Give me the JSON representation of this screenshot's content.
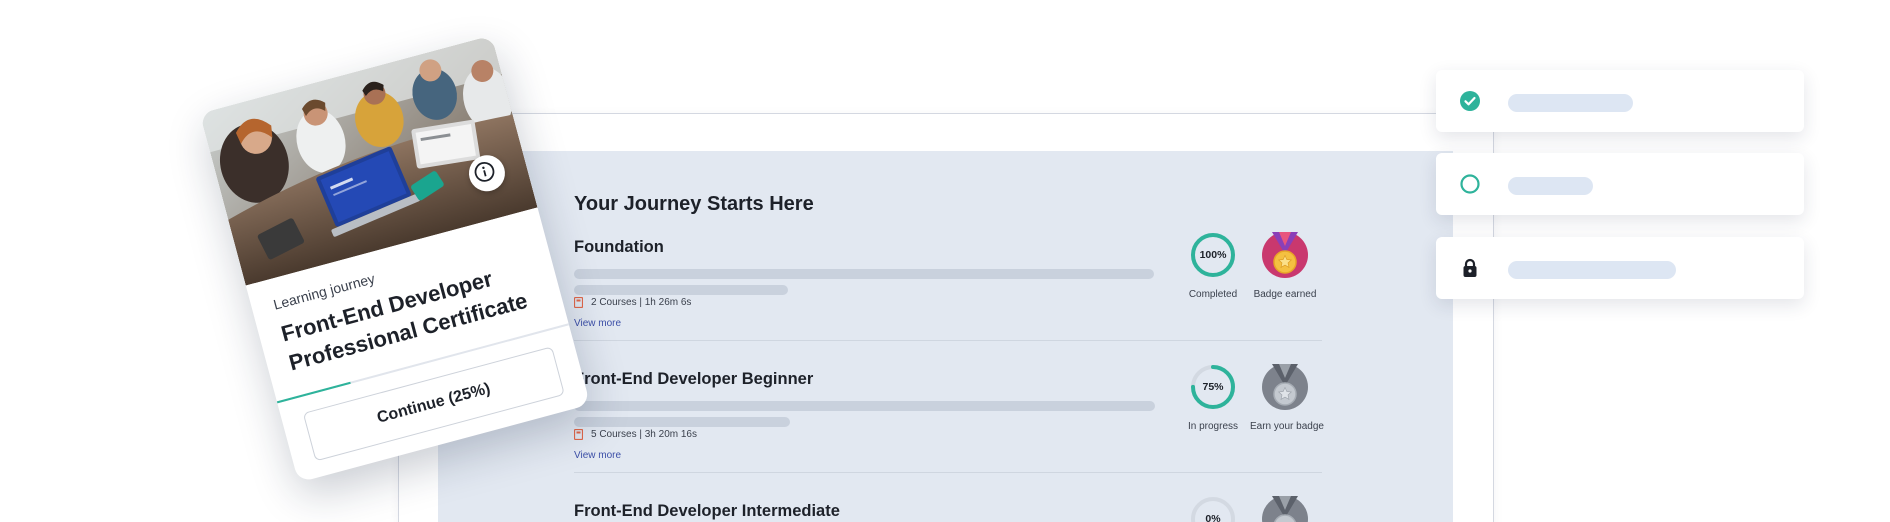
{
  "journey": {
    "heading": "Your Journey Starts Here",
    "modules": [
      {
        "title": "Foundation",
        "meta": "2 Courses | 1h 26m 6s",
        "view_more": "View more",
        "progress_label": "100%",
        "progress": 1.0,
        "status": "Completed",
        "badge_label": "Badge earned",
        "badge_state": "earned"
      },
      {
        "title": "Front-End Developer Beginner",
        "meta": "5 Courses | 3h 20m 16s",
        "view_more": "View more",
        "progress_label": "75%",
        "progress": 0.75,
        "status": "In progress",
        "badge_label": "Earn your badge",
        "badge_state": "locked"
      },
      {
        "title": "Front-End Developer Intermediate",
        "progress_label": "0%",
        "progress": 0.0,
        "badge_state": "locked"
      }
    ]
  },
  "card": {
    "eyebrow": "Learning journey",
    "title": "Front-End Developer Professional Certificate",
    "progress": 0.25,
    "button_label": "Continue (25%)",
    "photo_icon": "info-icon"
  },
  "checklist": [
    {
      "state": "done",
      "icon": "check-circle-icon",
      "bar_fraction": 0.44
    },
    {
      "state": "open",
      "icon": "empty-circle-icon",
      "bar_fraction": 0.3
    },
    {
      "state": "locked",
      "icon": "lock-icon",
      "bar_fraction": 0.59
    }
  ],
  "colors": {
    "accent": "#2eb39b",
    "content_bg": "#e2e8f1",
    "link": "#3c4fa8",
    "skeleton": "#c9d1dd",
    "checklist_bar": "#dde6f3",
    "badge_earned": "#c9386e",
    "badge_locked": "#7d828c"
  }
}
